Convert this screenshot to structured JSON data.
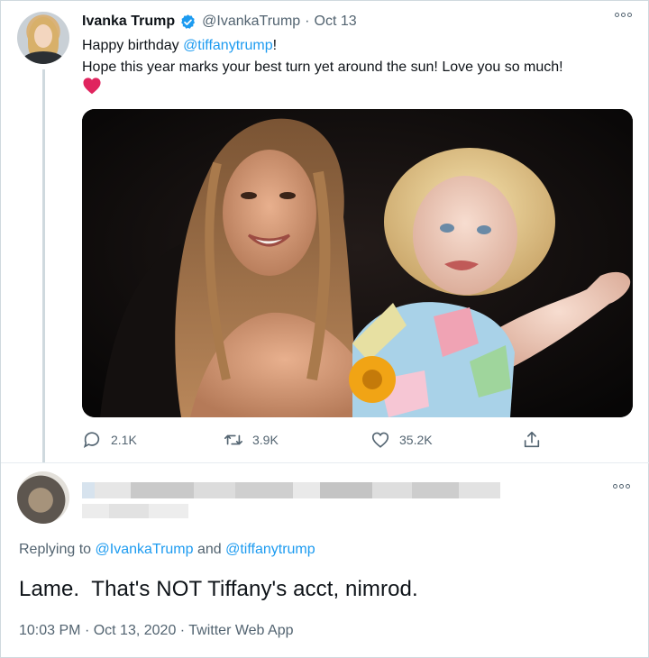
{
  "tweet": {
    "author_name": "Ivanka Trump",
    "author_handle": "@IvankaTrump",
    "separator": "·",
    "date": "Oct 13",
    "line1_prefix": "Happy birthday ",
    "line1_mention": "@tiffanytrump",
    "line1_suffix": "!",
    "line2": "Hope this year marks your best turn yet around the sun! Love you so much!",
    "emoji": "red-heart",
    "stats": {
      "replies": "2.1K",
      "retweets": "3.9K",
      "likes": "35.2K"
    }
  },
  "reply": {
    "replying_prefix": "Replying to ",
    "replying_to_1": "@IvankaTrump",
    "replying_and": " and ",
    "replying_to_2": "@tiffanytrump",
    "text": "Lame.  That's NOT Tiffany's acct, nimrod.",
    "time": "10:03 PM",
    "separator": "·",
    "date": "Oct 13, 2020",
    "client": "Twitter Web App"
  },
  "colors": {
    "accent": "#1d9bf0",
    "text": "#0f1419",
    "muted": "#536471",
    "heart": "#e0245e"
  }
}
